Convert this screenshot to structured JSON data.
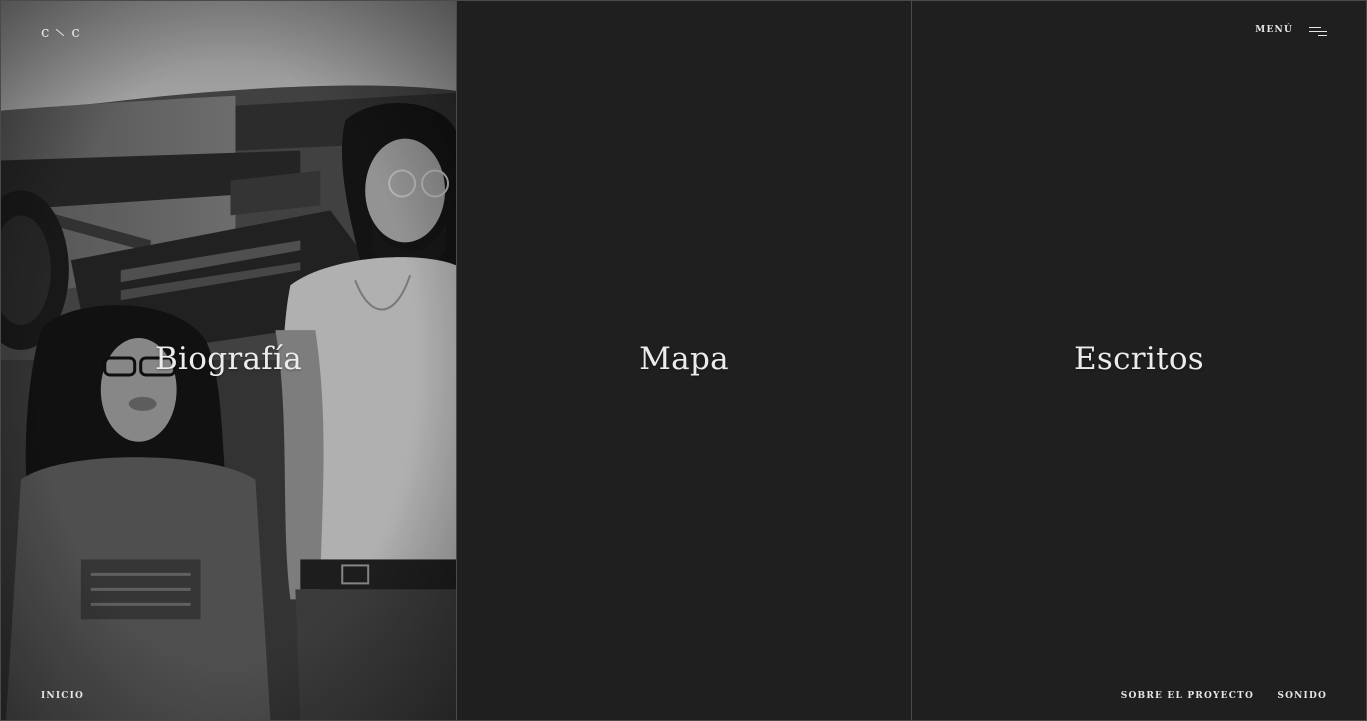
{
  "logo": {
    "left": "c",
    "right": "c"
  },
  "menu": {
    "label": "MENÚ"
  },
  "panels": [
    {
      "title": "Biografía"
    },
    {
      "title": "Mapa"
    },
    {
      "title": "Escritos"
    }
  ],
  "footer": {
    "home": "INICIO",
    "about": "SOBRE EL PROYECTO",
    "sound": "SONIDO"
  },
  "colors": {
    "background": "#1f1f1f",
    "text": "#ececec",
    "divider": "#4a4a4a"
  }
}
